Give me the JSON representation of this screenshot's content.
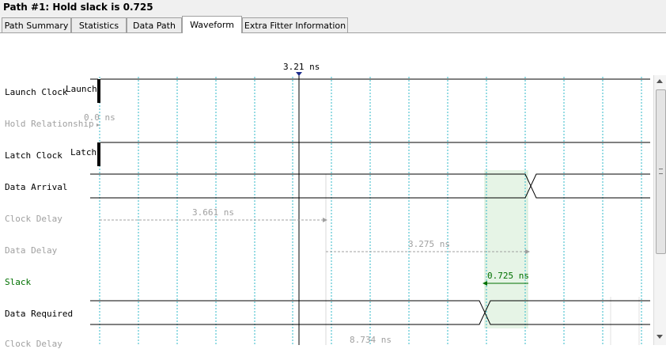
{
  "window": {
    "title": "Path #1: Hold slack is 0.725"
  },
  "tabs": [
    {
      "label": "Path Summary",
      "active": false
    },
    {
      "label": "Statistics",
      "active": false
    },
    {
      "label": "Data Path",
      "active": false
    },
    {
      "label": "Waveform",
      "active": true
    },
    {
      "label": "Extra Fitter Information",
      "active": false
    }
  ],
  "cursor": {
    "label": "3.21 ns"
  },
  "rows": [
    {
      "label": "Launch Clock",
      "style": "normal"
    },
    {
      "label": "Hold Relationship",
      "style": "muted"
    },
    {
      "label": "Latch Clock",
      "style": "normal"
    },
    {
      "label": "Data Arrival",
      "style": "normal"
    },
    {
      "label": "Clock Delay",
      "style": "muted"
    },
    {
      "label": "Data Delay",
      "style": "muted"
    },
    {
      "label": "Slack",
      "style": "slack"
    },
    {
      "label": "Data Required",
      "style": "normal"
    },
    {
      "label": "Clock Delay",
      "style": "muted"
    }
  ],
  "annotations": {
    "launch_tag": "Launch",
    "latch_tag": "Latch",
    "hold_relationship": "0.0 ns",
    "clock_delay": "3.661 ns",
    "data_delay": "3.275 ns",
    "slack": "0.725 ns",
    "required_clock_delay": "8.734 ns"
  },
  "colors": {
    "grid": "#30b8c8",
    "slack": "#007000",
    "slack_fill": "#e8f5e8",
    "muted": "#a0a0a0",
    "cursor_marker": "#1a2a8a"
  }
}
